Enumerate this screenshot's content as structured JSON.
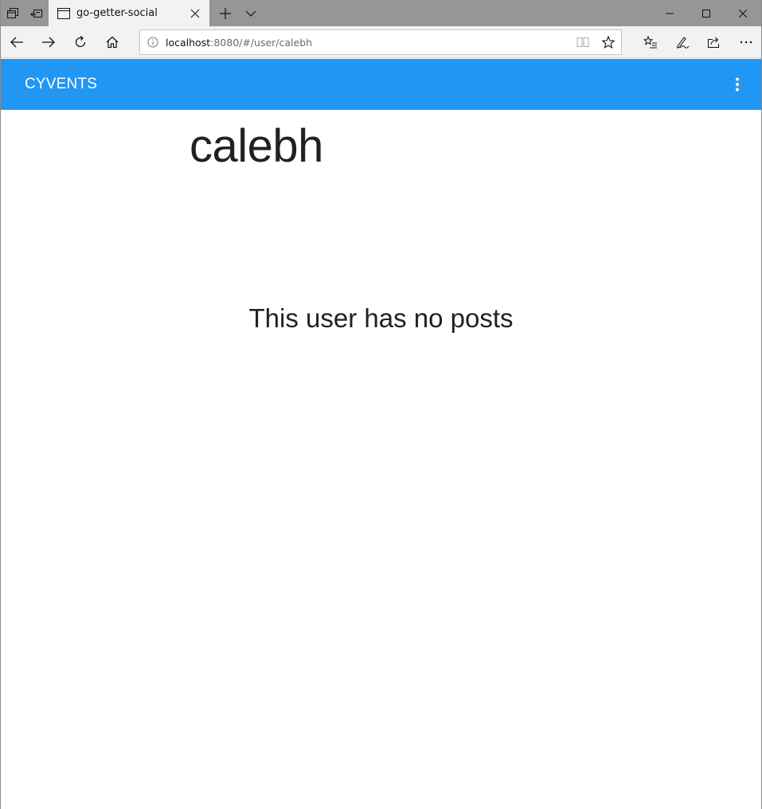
{
  "browser": {
    "tab": {
      "title": "go-getter-social"
    },
    "address": {
      "host": "localhost",
      "path": ":8080/#/user/calebh"
    },
    "icons": {
      "tab_preview": "tabs-aside-icon",
      "set_aside": "set-aside-icon",
      "page": "page-icon",
      "close": "close-icon",
      "new_tab": "plus-icon",
      "tab_list": "chevron-down-icon",
      "back": "back-arrow-icon",
      "forward": "forward-arrow-icon",
      "refresh": "refresh-icon",
      "home": "home-icon",
      "info": "info-icon",
      "reading": "reading-view-icon",
      "favorite": "star-icon",
      "favorites_hub": "favorites-list-icon",
      "notes": "pen-icon",
      "share": "share-icon",
      "more": "more-icon"
    }
  },
  "app": {
    "title": "CYVENTS",
    "accent": "#2196f3"
  },
  "profile": {
    "username": "calebh",
    "empty_message": "This user has no posts"
  }
}
